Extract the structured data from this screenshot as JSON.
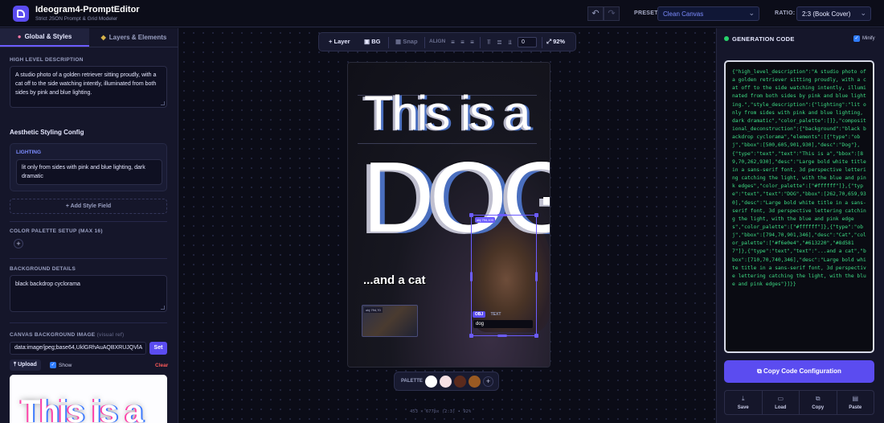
{
  "header": {
    "app_title": "Ideogram4-PromptEditor",
    "app_subtitle": "Strict JSON Prompt & Grid Modeler",
    "undo_icon": "undo-icon",
    "redo_icon": "redo-icon",
    "preset_label": "PRESET:",
    "preset_value": "Clean Canvas",
    "ratio_label": "RATIO:",
    "ratio_value": "2:3 (Book Cover)"
  },
  "left_panel": {
    "tabs": [
      {
        "label": "Global & Styles",
        "icon": "palette-icon",
        "active": true
      },
      {
        "label": "Layers & Elements",
        "icon": "layers-icon",
        "active": false
      }
    ],
    "high_level_label": "HIGH LEVEL DESCRIPTION",
    "high_level_text": "A studio photo of a golden retriever sitting proudly, with a cat off to the side watching intently, illuminated from both sides by pink and blue lighting.",
    "aesthetic_heading": "Aesthetic Styling Config",
    "lighting_label": "LIGHTING",
    "lighting_text": "lit only from sides with pink and blue lighting, dark dramatic",
    "add_style_label": "+ Add Style Field",
    "color_palette_label": "COLOR PALETTE SETUP (MAX 16)",
    "background_label": "BACKGROUND DETAILS",
    "background_text": "black backdrop cyclorama",
    "canvas_bg_label": "CANVAS BACKGROUND IMAGE",
    "canvas_bg_sublabel": "(visual ref)",
    "canvas_bg_value": "data:image/jpeg;base64,UklGRhAuAQBXRUJQVlA",
    "set_label": "Set",
    "upload_label": "Upload",
    "show_label": "Show",
    "clear_label": "Clear",
    "thumb_text": "This is a"
  },
  "toolbar": {
    "layer_label": "Layer",
    "bg_label": "BG",
    "snap_label": "Snap",
    "align_label": "ALIGN",
    "rotation_value": "0",
    "zoom_label": "92%"
  },
  "canvas": {
    "title_text": "This is a",
    "dog_text": "DOG",
    "cat_caption": "...and a cat",
    "selection_tag": "obj 794,103",
    "small_tag": "obj 794,70",
    "obj_button": "OBJ",
    "text_button": "TEXT",
    "element_desc": "dog"
  },
  "palette": {
    "label": "PALETTE",
    "colors": [
      "#ffffff",
      "#f6e0e4",
      "#5b2a1c",
      "#9a5a22"
    ]
  },
  "canvas_dims": "453 × 677px (2:3) • 92%",
  "right_panel": {
    "title": "GENERATION CODE",
    "minify_label": "Minify",
    "code": "{\"high_level_description\":\"A studio photo of a golden retriever sitting proudly, with a cat off to the side watching intently, illuminated from both sides by pink and blue lighting.\",\"style_description\":{\"lighting\":\"lit only from sides with pink and blue lighting, dark dramatic\",\"color_palette\":[]},\"compositional_deconstruction\":{\"background\":\"black backdrop cyclorama\",\"elements\":[{\"type\":\"obj\",\"bbox\":[500,605,901,930],\"desc\":\"Dog\"},{\"type\":\"text\",\"text\":\"This is a\",\"bbox\":[89,70,262,930],\"desc\":\"Large bold white title in a sans-serif font, 3d perspective lettering catching the light, with the blue and pink edges\",\"color_palette\":[\"#ffffff\"]},{\"type\":\"text\",\"text\":\"DOG\",\"bbox\":[262,70,659,930],\"desc\":\"Large bold white title in a sans-serif font, 3d perspective lettering catching the light, with the blue and pink edges\",\"color_palette\":[\"#ffffff\"]},{\"type\":\"obj\",\"bbox\":[794,70,901,346],\"desc\":\"Cat\",\"color_palette\":[\"#f6e0e4\",\"#613220\",\"#8d5817\"]},{\"type\":\"text\",\"text\":\"...and a cat\",\"bbox\":[710,70,740,346],\"desc\":\"Large bold white title in a sans-serif font, 3d perspective lettering catching the light, with the blue and pink edges\"}]}}",
    "copy_label": "Copy Code Configuration",
    "actions": [
      {
        "label": "Save",
        "icon": "download-icon"
      },
      {
        "label": "Load",
        "icon": "folder-icon"
      },
      {
        "label": "Copy",
        "icon": "copy-icon"
      },
      {
        "label": "Paste",
        "icon": "clipboard-icon"
      }
    ]
  }
}
